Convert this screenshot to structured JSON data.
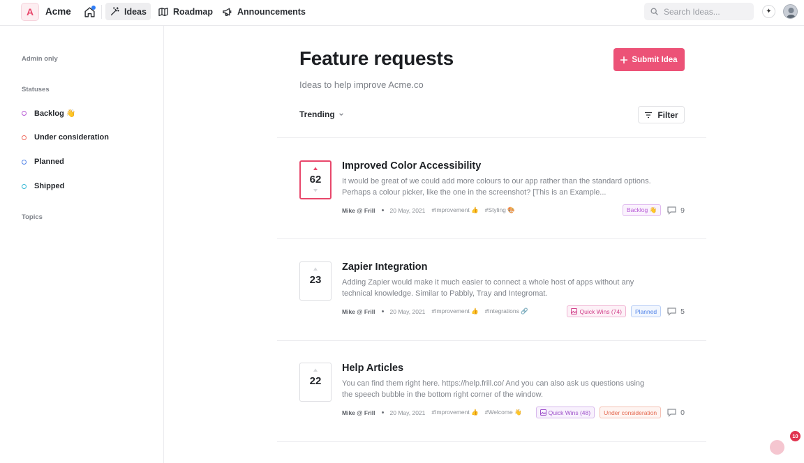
{
  "topbar": {
    "logo_letter": "A",
    "brand": "Acme",
    "nav": [
      {
        "label": "Ideas",
        "active": true
      },
      {
        "label": "Roadmap",
        "active": false
      },
      {
        "label": "Announcements",
        "active": false
      }
    ],
    "search_placeholder": "Search Ideas...",
    "accent_color": "#ec5277"
  },
  "sidebar": {
    "admin_heading": "Admin only",
    "statuses_heading": "Statuses",
    "statuses": [
      {
        "label": "Backlog 👋",
        "color": "#b85bd6"
      },
      {
        "label": "Under consideration",
        "color": "#ef6a5e"
      },
      {
        "label": "Planned",
        "color": "#4f82e8"
      },
      {
        "label": "Shipped",
        "color": "#31b6d4"
      }
    ],
    "topics_heading": "Topics"
  },
  "main": {
    "title": "Feature requests",
    "subtitle": "Ideas to help improve Acme.co",
    "submit_label": "Submit Idea",
    "sort_label": "Trending",
    "filter_label": "Filter"
  },
  "ideas": [
    {
      "votes": "62",
      "voted": true,
      "title": "Improved Color Accessibility",
      "description": "It would be great of we could add more colours to our app rather than the standard options. Perhaps a colour picker, like the one in the screenshot? [This is an Example...",
      "author": "Mike @ Frill",
      "date": "20 May, 2021",
      "topics": [
        "#Improvement 👍",
        "#Styling 🎨"
      ],
      "tags": [
        {
          "label": "Backlog 👋",
          "kind": "backlog"
        }
      ],
      "comments": "9"
    },
    {
      "votes": "23",
      "voted": false,
      "title": "Zapier Integration",
      "description": "Adding Zapier would make it much easier to connect a whole host of apps without any technical knowledge. Similar to Pabbly, Tray and Integromat.",
      "author": "Mike @ Frill",
      "date": "20 May, 2021",
      "topics": [
        "#Improvement 👍",
        "#Integrations 🔗"
      ],
      "tags": [
        {
          "label": "Quick Wins (74)",
          "kind": "quickwins-pink"
        },
        {
          "label": "Planned",
          "kind": "planned"
        }
      ],
      "comments": "5"
    },
    {
      "votes": "22",
      "voted": false,
      "title": "Help Articles",
      "description": "You can find them right here. https://help.frill.co/ And you can also ask us questions using the speech bubble in the bottom right corner of the window.",
      "author": "Mike @ Frill",
      "date": "20 May, 2021",
      "topics": [
        "#Improvement 👍",
        "#Welcome 👋"
      ],
      "tags": [
        {
          "label": "Quick Wins (48)",
          "kind": "quickwins-purple"
        },
        {
          "label": "Under consideration",
          "kind": "consideration"
        }
      ],
      "comments": "0"
    }
  ],
  "notification_count": "10"
}
